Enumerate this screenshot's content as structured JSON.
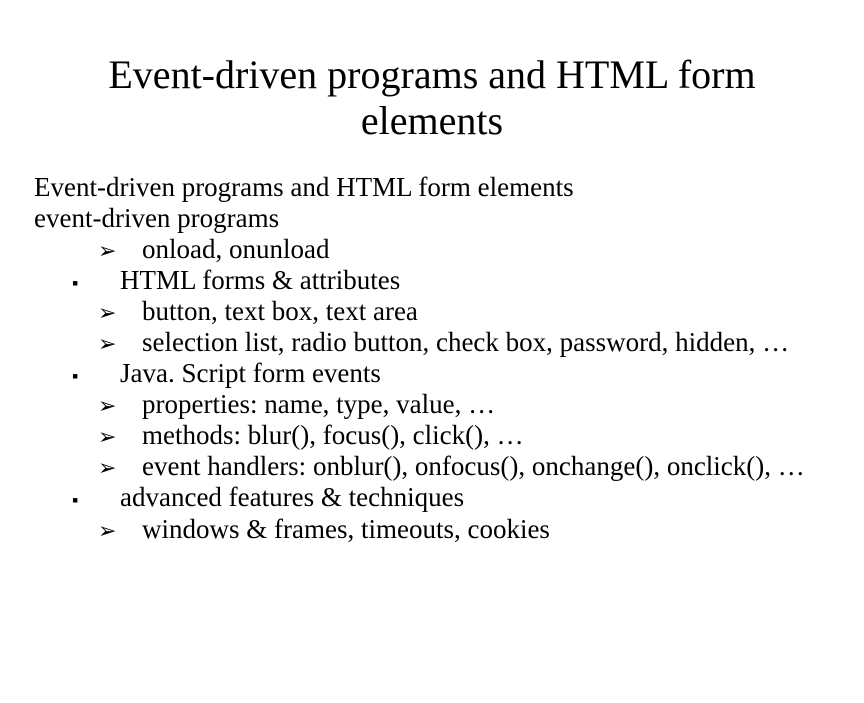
{
  "title": "Event-driven programs and HTML form elements",
  "lines": {
    "l1": "Event-driven programs and HTML form elements",
    "l2": "event-driven programs",
    "l3": "onload, onunload",
    "l4": "HTML forms & attributes",
    "l5": "button, text box, text area",
    "l6": "selection list, radio button, check box, password, hidden, …",
    "l7": "Java. Script form events",
    "l8": "properties: name, type, value, …",
    "l9": "methods: blur(), focus(), click(), …",
    "l10": "event handlers: onblur(), onfocus(), onchange(), onclick(), …",
    "l11": "advanced features & techniques",
    "l12": "windows & frames, timeouts, cookies"
  }
}
